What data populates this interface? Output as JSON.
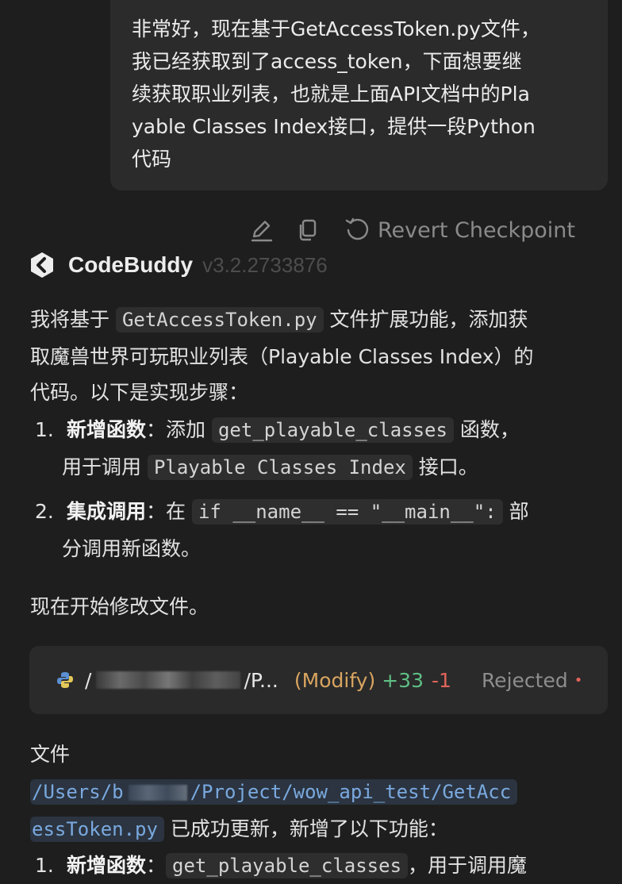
{
  "user_message": {
    "lines": [
      "非常好，现在基于GetAccessToken.py文件，",
      "我已经获取到了access_token，下面想要继",
      "续获取职业列表，也就是上面API文档中的Pla",
      "yable Classes Index接口，提供一段Python",
      "代码"
    ]
  },
  "actions": {
    "edit_icon": "pencil-icon",
    "copy_icon": "copy-icon",
    "revert_label": "Revert Checkpoint"
  },
  "assistant": {
    "name": "CodeBuddy",
    "version": "v3.2.2733876"
  },
  "reply": {
    "intro_pre": "我将基于 ",
    "intro_code": "GetAccessToken.py",
    "intro_post": " 文件扩展功能，添加获",
    "intro_line2": "取魔兽世界可玩职业列表（Playable Classes Index）的",
    "intro_line3": "代码。以下是实现步骤：",
    "step1_num": "1.",
    "step1_bold": "新增函数",
    "step1_pre": "：添加 ",
    "step1_code": "get_playable_classes",
    "step1_post": " 函数，",
    "step1_line2_pre": "用于调用 ",
    "step1_line2_code": "Playable Classes Index",
    "step1_line2_post": " 接口。",
    "step2_num": "2.",
    "step2_bold": "集成调用",
    "step2_pre": "：在 ",
    "step2_code": "if __name__ == \"__main__\":",
    "step2_post": " 部",
    "step2_line2": "分调用新函数。",
    "start": "现在开始修改文件。"
  },
  "file_card": {
    "path_prefix": "/",
    "path_suffix": "/P...",
    "action": "(Modify)",
    "added": "+33",
    "removed": "-1",
    "status": "Rejected",
    "status_dot": "•"
  },
  "result": {
    "label": "文件",
    "path_part1": "/Users/b",
    "path_part2": "/Project/wow_api_test/GetAcc",
    "path_part3": "essToken.py",
    "post": " 已成功更新，新增了以下功能：",
    "item1_num": "1.",
    "item1_bold": "新增函数",
    "item1_pre": "：",
    "item1_code": "get_playable_classes",
    "item1_post": "，用于调用魔"
  },
  "colors": {
    "background": "#1e1e1e",
    "bubble": "#2b2b2b",
    "added": "#5fbf84",
    "removed": "#e0645a",
    "modify": "#d9a560",
    "path": "#7aa9df"
  }
}
